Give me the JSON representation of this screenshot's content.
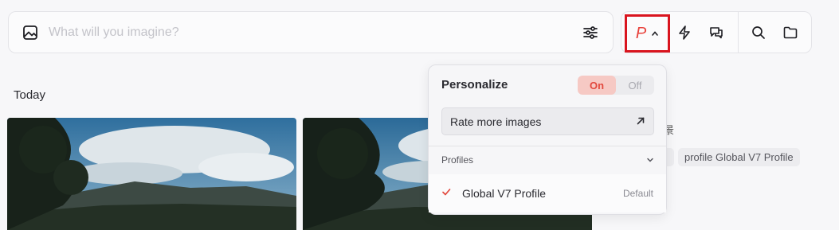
{
  "prompt": {
    "placeholder": "What will you imagine?",
    "image_icon": "image-icon",
    "settings_icon": "sliders-icon"
  },
  "toolbar": {
    "personalize_letter": "P",
    "personalize_chevron": "chevron-up-icon",
    "icons": [
      "lightning-icon",
      "chat-bubbles-icon",
      "search-icon",
      "folder-icon"
    ],
    "highlight_color": "#d9141e"
  },
  "feed": {
    "section_title": "Today",
    "peek_title": "風景",
    "tags": [
      "/",
      "profile Global V7 Profile"
    ]
  },
  "personalize_panel": {
    "title": "Personalize",
    "toggle_on": "On",
    "toggle_off": "Off",
    "toggle_state": "On",
    "rate_button": "Rate more images",
    "profiles_label": "Profiles",
    "profiles": [
      {
        "name": "Global V7 Profile",
        "badge": "Default",
        "selected": true
      }
    ],
    "accent_color": "#e2483d"
  }
}
